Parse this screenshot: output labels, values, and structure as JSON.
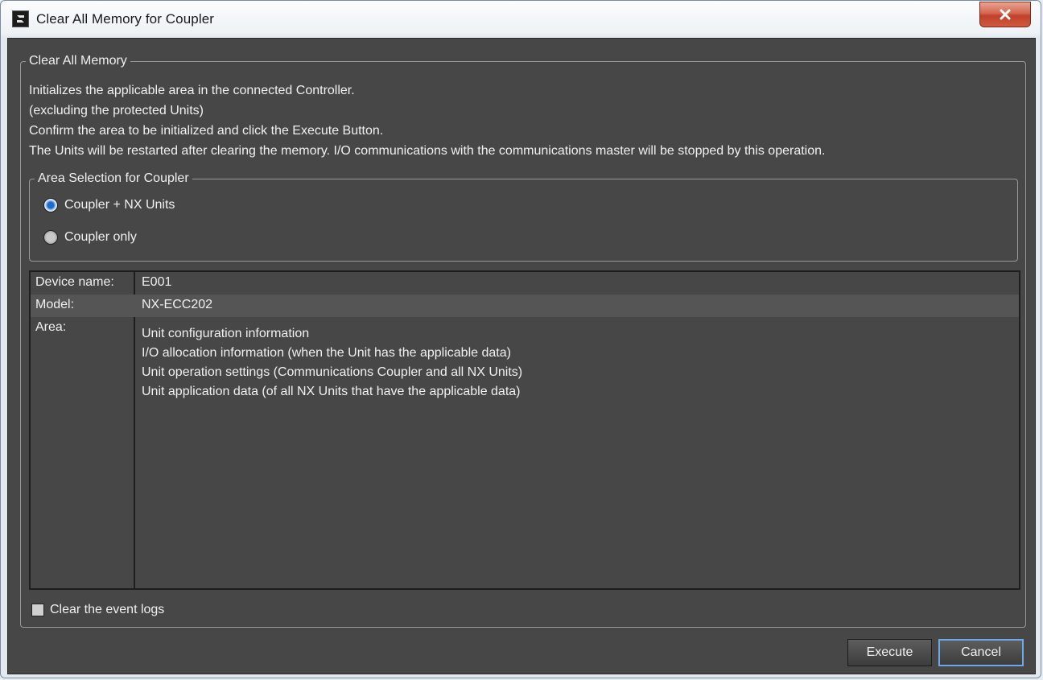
{
  "window": {
    "title": "Clear All Memory for Coupler",
    "close_label": "x"
  },
  "main_group": {
    "legend": "Clear All Memory",
    "lines": [
      "Initializes the applicable area in the connected Controller.",
      "(excluding the protected Units)",
      "Confirm the area to be initialized and click the Execute Button.",
      "The Units will be restarted after clearing the memory. I/O communications with the communications master will be stopped by this operation."
    ]
  },
  "area_selection": {
    "legend": "Area Selection for Coupler",
    "options": [
      {
        "label": "Coupler + NX Units",
        "selected": true
      },
      {
        "label": "Coupler only",
        "selected": false
      }
    ]
  },
  "info": {
    "device_name_label": "Device name:",
    "device_name_value": "E001",
    "model_label": "Model:",
    "model_value": "NX-ECC202",
    "area_label": "Area:",
    "area_lines": [
      "Unit configuration information",
      "I/O allocation information (when the Unit has the applicable data)",
      "Unit operation settings (Communications Coupler and all NX Units)",
      "Unit application data (of all NX Units that have the applicable data)"
    ]
  },
  "event_logs": {
    "label": "Clear the event logs",
    "checked": false
  },
  "buttons": {
    "execute": "Execute",
    "cancel": "Cancel"
  },
  "colors": {
    "panel": "#474747",
    "accent": "#1f6cc8",
    "close": "#c1402a"
  }
}
